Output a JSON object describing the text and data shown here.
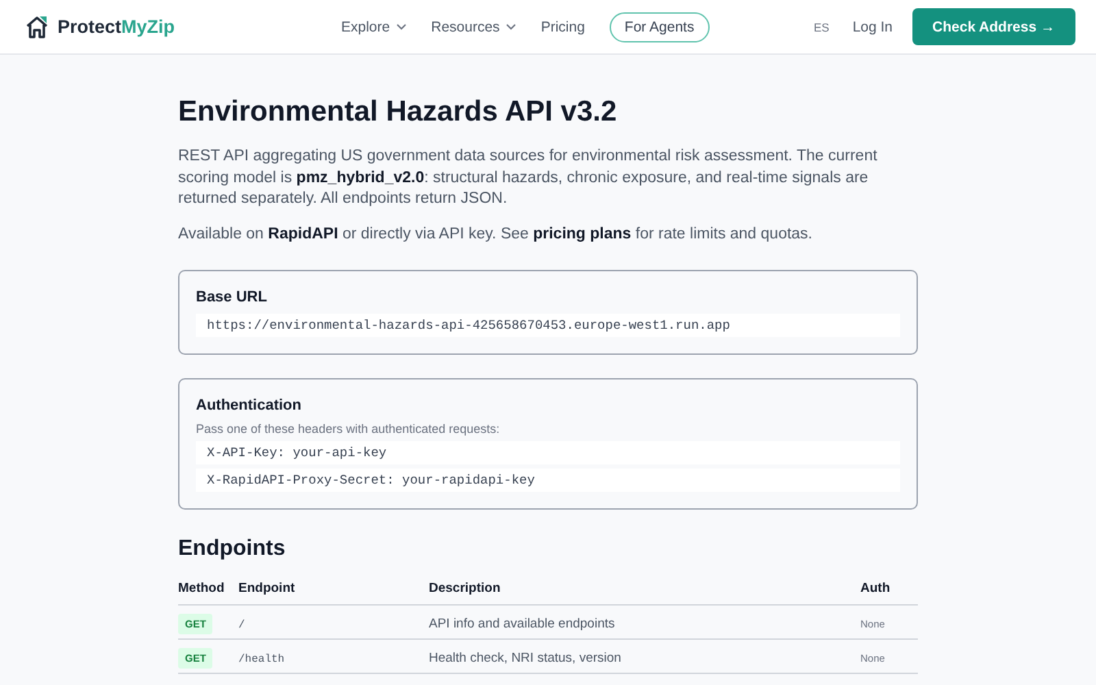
{
  "header": {
    "logo": {
      "brand_main": "Protect",
      "brand_accent": "MyZip"
    },
    "nav": [
      {
        "label": "Explore",
        "kind": "dropdown"
      },
      {
        "label": "Resources",
        "kind": "dropdown"
      },
      {
        "label": "Pricing",
        "kind": "link"
      },
      {
        "label": "For Agents",
        "kind": "pill"
      }
    ],
    "language": "ES",
    "login": "Log In",
    "cta": "Check Address →"
  },
  "title": "Environmental Hazards API v3.2",
  "intro": "REST API aggregating US government data sources for environmental risk assessment. The current scoring model is **pmz_hybrid_v2.0**: structural hazards, chronic exposure, and real-time signals are returned separately. All endpoints return JSON.",
  "availability": "Available on **RapidAPI** or directly via API key. See **pricing plans** for rate limits and quotas.",
  "cards": [
    {
      "title": "Base URL",
      "lines": [
        "https://environmental-hazards-api-425658670453.europe-west1.run.app"
      ]
    },
    {
      "title": "Authentication",
      "note": "Pass one of these headers with authenticated requests:",
      "lines": [
        "X-API-Key: your-api-key",
        "X-RapidAPI-Proxy-Secret: your-rapidapi-key"
      ]
    }
  ],
  "endpoints": {
    "heading": "Endpoints",
    "columns": [
      "Method",
      "Endpoint",
      "Description",
      "Auth"
    ],
    "rows": [
      {
        "method": "GET",
        "path": "/",
        "description": "API info and available endpoints",
        "auth": "None"
      },
      {
        "method": "GET",
        "path": "/health",
        "description": "Health check, NRI status, version",
        "auth": "None"
      }
    ]
  }
}
